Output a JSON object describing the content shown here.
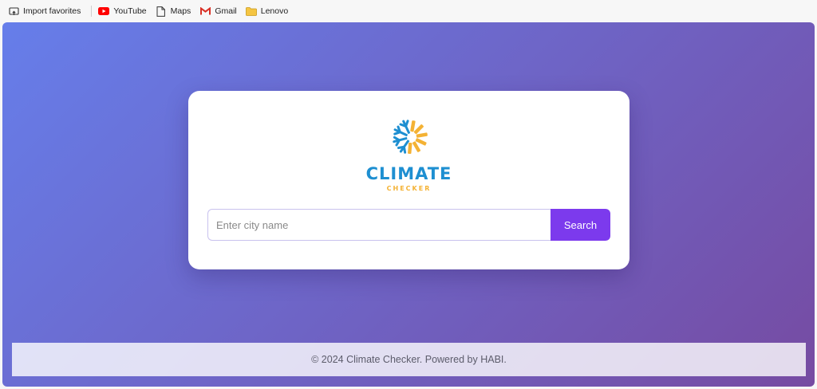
{
  "favorites": [
    {
      "name": "import-favorites",
      "label": "Import favorites",
      "icon": "import-icon"
    },
    {
      "name": "youtube",
      "label": "YouTube",
      "icon": "youtube-icon"
    },
    {
      "name": "maps",
      "label": "Maps",
      "icon": "page-icon"
    },
    {
      "name": "gmail",
      "label": "Gmail",
      "icon": "gmail-icon"
    },
    {
      "name": "lenovo",
      "label": "Lenovo",
      "icon": "folder-icon"
    }
  ],
  "logo": {
    "title": "CLIMATE",
    "subtitle": "CHECKER",
    "icon": "snowflake-sun-icon"
  },
  "search": {
    "placeholder": "Enter city name",
    "value": "",
    "button_label": "Search"
  },
  "footer": {
    "text": "© 2024 Climate Checker. Powered by HABI."
  },
  "colors": {
    "gradient_start": "#667eea",
    "gradient_end": "#764ba2",
    "button": "#7c3aed",
    "logo_blue": "#1e8fd1",
    "logo_yellow": "#f4b234"
  }
}
